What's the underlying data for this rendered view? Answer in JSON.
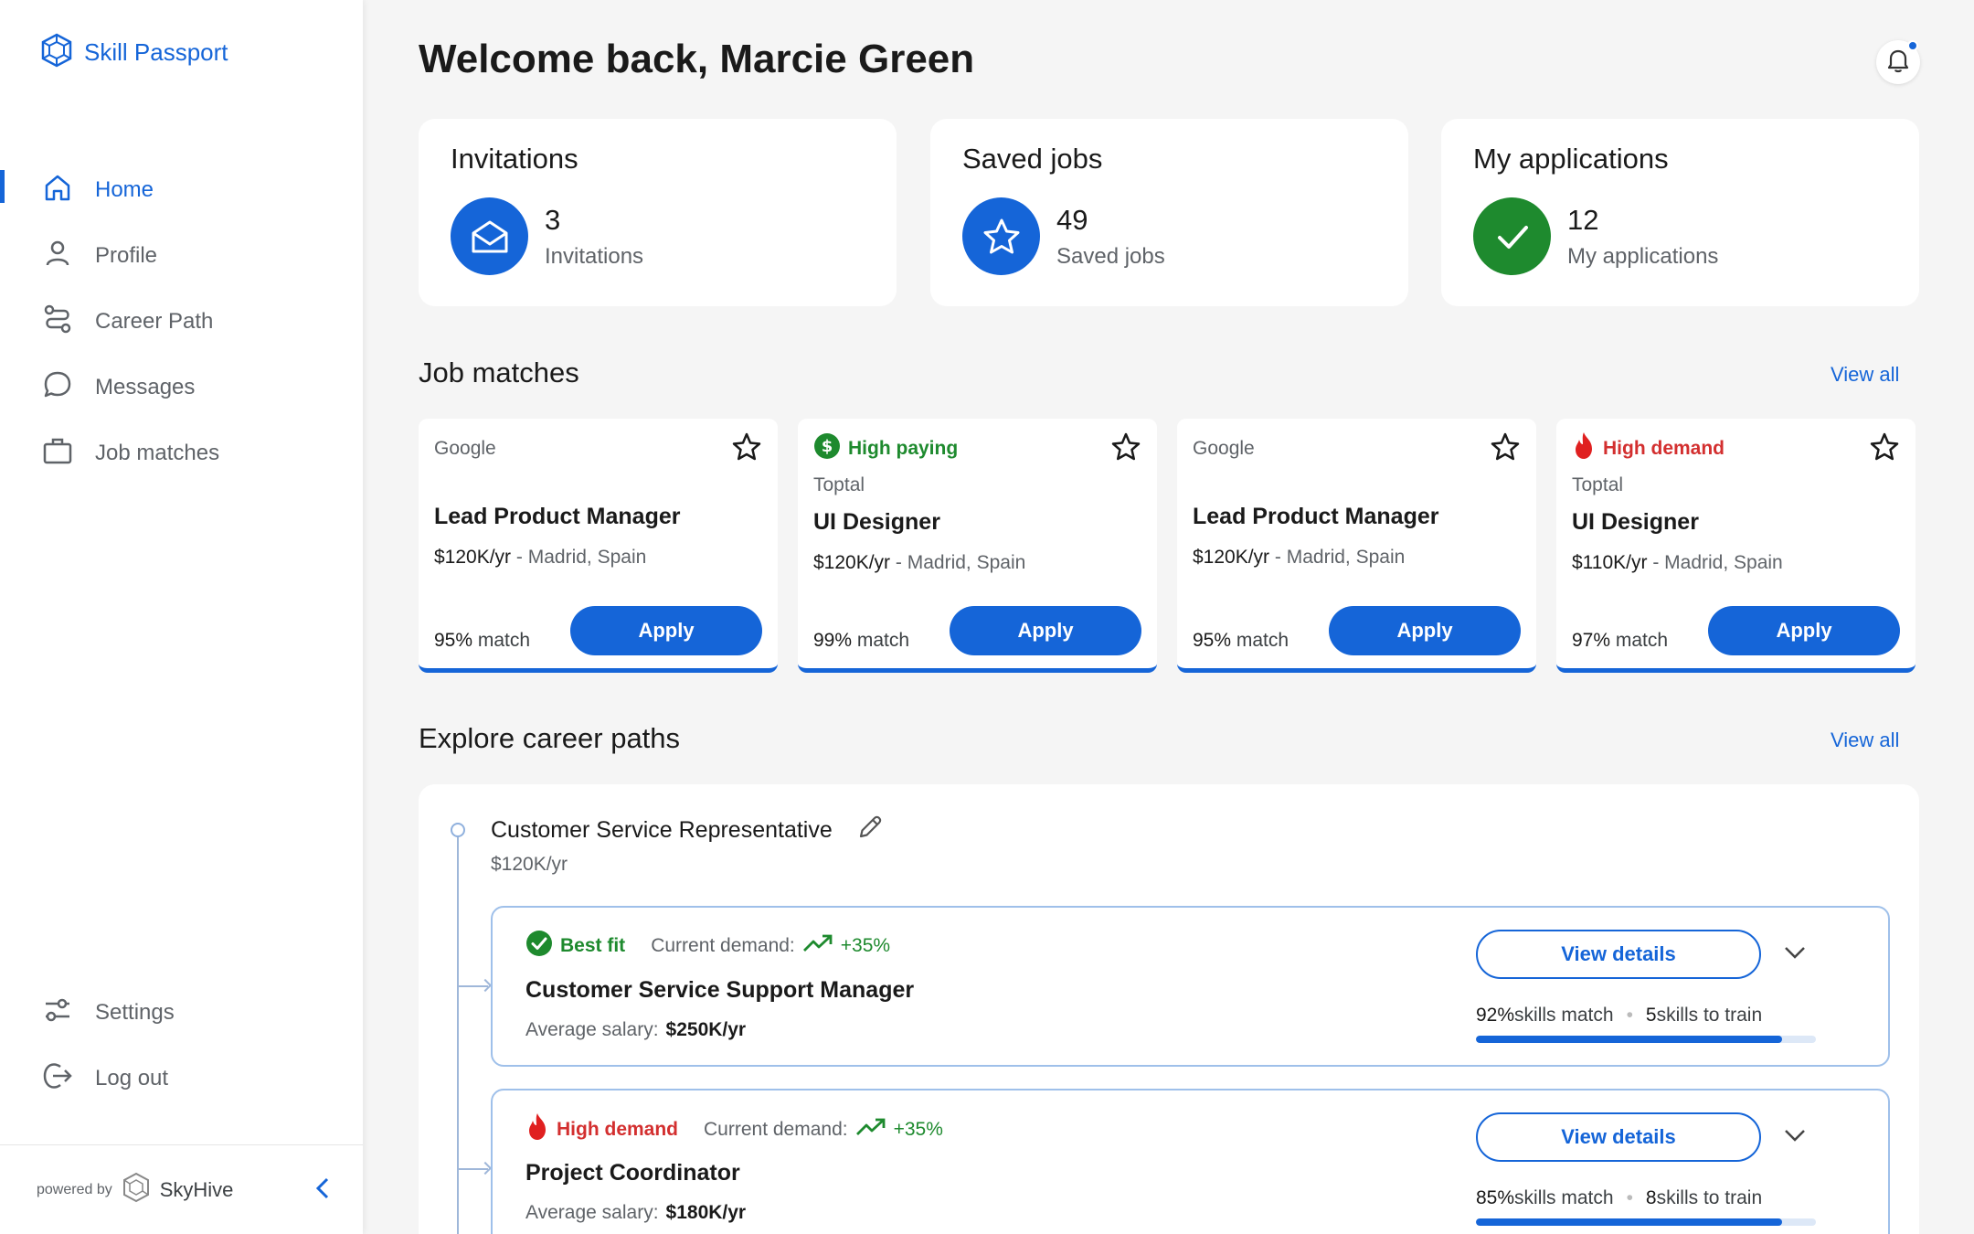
{
  "app": {
    "name": "Skill Passport"
  },
  "nav": {
    "items": [
      {
        "label": "Home",
        "icon": "home-icon",
        "active": true
      },
      {
        "label": "Profile",
        "icon": "user-icon",
        "active": false
      },
      {
        "label": "Career Path",
        "icon": "route-icon",
        "active": false
      },
      {
        "label": "Messages",
        "icon": "chat-icon",
        "active": false
      },
      {
        "label": "Job matches",
        "icon": "briefcase-icon",
        "active": false
      }
    ],
    "bottom": [
      {
        "label": "Settings",
        "icon": "sliders-icon"
      },
      {
        "label": "Log out",
        "icon": "logout-icon"
      }
    ]
  },
  "footer": {
    "powered_by": "powered by",
    "brand": "SkyHive"
  },
  "header": {
    "title": "Welcome back, Marcie Green"
  },
  "stats": [
    {
      "title": "Invitations",
      "value": "3",
      "label": "Invitations",
      "color": "#1565d8",
      "icon": "envelope-icon"
    },
    {
      "title": "Saved jobs",
      "value": "49",
      "label": "Saved jobs",
      "color": "#1565d8",
      "icon": "star-icon"
    },
    {
      "title": "My applications",
      "value": "12",
      "label": "My applications",
      "color": "#1e8a2e",
      "icon": "check-icon"
    }
  ],
  "job_matches": {
    "title": "Job matches",
    "view_all": "View all",
    "cards": [
      {
        "tag": "",
        "company": "Google",
        "title": "Lead Product Manager",
        "salary": "$120K/yr",
        "location": " - Madrid, Spain",
        "match_pct": "95%",
        "match_text": " match",
        "apply": "Apply"
      },
      {
        "tag": "High paying",
        "tag_type": "green",
        "company": "Toptal",
        "title": "UI Designer",
        "salary": "$120K/yr",
        "location": " - Madrid, Spain",
        "match_pct": "99%",
        "match_text": " match",
        "apply": "Apply"
      },
      {
        "tag": "",
        "company": "Google",
        "title": "Lead Product Manager",
        "salary": "$120K/yr",
        "location": " - Madrid, Spain",
        "match_pct": "95%",
        "match_text": " match",
        "apply": "Apply"
      },
      {
        "tag": "High demand",
        "tag_type": "red",
        "company": "Toptal",
        "title": "UI Designer",
        "salary": "$110K/yr",
        "location": " - Madrid, Spain",
        "match_pct": "97%",
        "match_text": " match",
        "apply": "Apply"
      }
    ]
  },
  "career_paths": {
    "title": "Explore career paths",
    "view_all": "View all",
    "current": {
      "title": "Customer Service Representative",
      "salary": "$120K/yr"
    },
    "paths": [
      {
        "tag": "Best fit",
        "tag_type": "green",
        "demand_label": "Current demand:",
        "demand_pct": "+35%",
        "title": "Customer Service Support Manager",
        "salary_label": "Average salary:",
        "salary": "$250K/yr",
        "details": "View details",
        "skills_pct": "92%",
        "skills_match": " skills match",
        "train_count": "5",
        "train_text": " skills to train",
        "progress": 0.9
      },
      {
        "tag": "High demand",
        "tag_type": "red",
        "demand_label": "Current demand:",
        "demand_pct": "+35%",
        "title": "Project Coordinator",
        "salary_label": "Average salary:",
        "salary": "$180K/yr",
        "details": "View details",
        "skills_pct": "85%",
        "skills_match": " skills match",
        "train_count": "8",
        "train_text": " skills to train",
        "progress": 0.9
      }
    ]
  }
}
